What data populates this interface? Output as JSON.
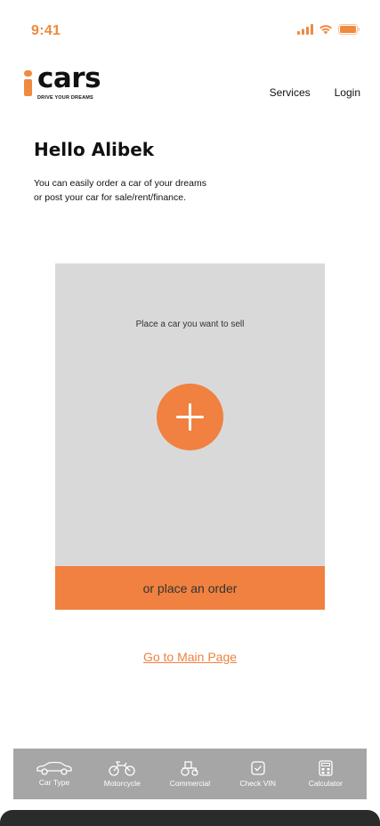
{
  "status": {
    "time": "9:41",
    "accent_color": "#f08a3e"
  },
  "brand": {
    "name": "cars",
    "tagline": "DRIVE YOUR DREAMS",
    "color": "#f08a3e"
  },
  "nav": {
    "items": [
      {
        "label": "Services"
      },
      {
        "label": "Login"
      }
    ]
  },
  "hero": {
    "title": "Hello Alibek",
    "line1": "You can easily order a car of your dreams",
    "line2": "or post your car for sale/rent/finance."
  },
  "sell_card": {
    "label": "Place a car you want to sell",
    "add_icon": "plus-icon",
    "order_label": "or place an order"
  },
  "footer_link": {
    "label": "Go to Main Page"
  },
  "tabbar": {
    "items": [
      {
        "label": "Car Type",
        "icon": "car-icon"
      },
      {
        "label": "Motorcycle",
        "icon": "motorcycle-icon"
      },
      {
        "label": "Commercial",
        "icon": "tractor-icon"
      },
      {
        "label": "Check VIN",
        "icon": "checkbox-icon"
      },
      {
        "label": "Calculator",
        "icon": "calculator-icon"
      }
    ]
  },
  "colors": {
    "accent": "#f08140",
    "card": "#d9d9d9",
    "tabbar": "#a6a6a6"
  }
}
